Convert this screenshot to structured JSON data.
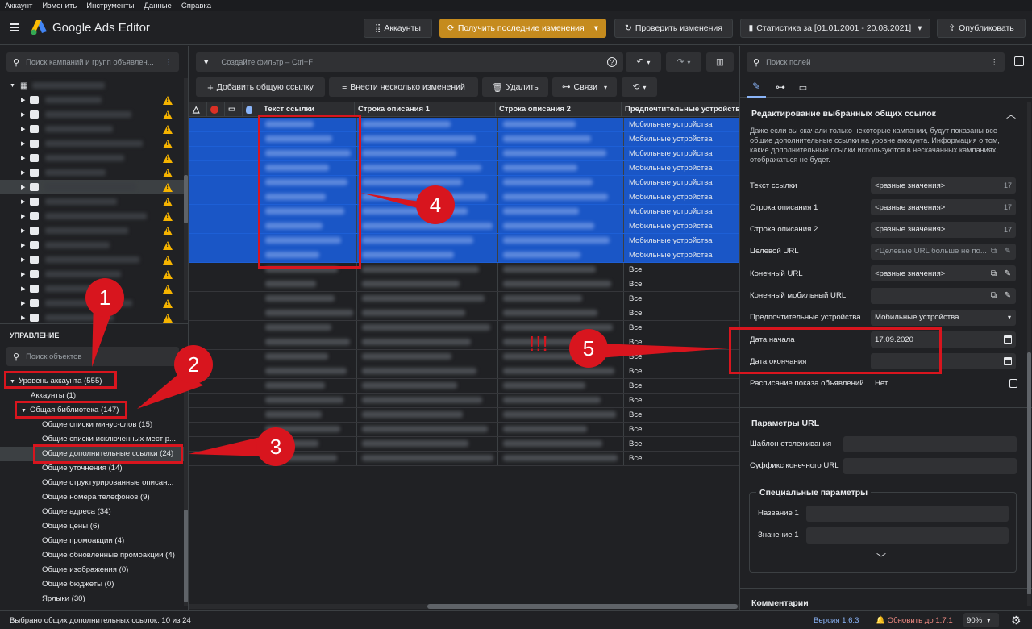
{
  "menu": [
    "Аккаунт",
    "Изменить",
    "Инструменты",
    "Данные",
    "Справка"
  ],
  "app_title": "Google Ads Editor",
  "toolbar": {
    "accounts": "Аккаунты",
    "get_changes": "Получить последние изменения",
    "check_changes": "Проверить изменения",
    "stats": "Статистика за [01.01.2001 - 20.08.2021]",
    "publish": "Опубликовать"
  },
  "left": {
    "search_placeholder": "Поиск кампаний и групп объявлен...",
    "management_title": "УПРАВЛЕНИЕ",
    "objects_placeholder": "Поиск объектов",
    "items": [
      "Уровень аккаунта (555)",
      "Аккаунты (1)",
      "Общая библиотека (147)",
      "Общие списки минус-слов (15)",
      "Общие списки исключенных мест р...",
      "Общие дополнительные ссылки (24)",
      "Общие уточнения (14)",
      "Общие структурированные описан...",
      "Общие номера телефонов (9)",
      "Общие адреса (34)",
      "Общие цены (6)",
      "Общие промоакции (4)",
      "Общие обновленные промоакции (4)",
      "Общие изображения (0)",
      "Общие бюджеты (0)",
      "Ярлыки (30)"
    ]
  },
  "center": {
    "filter_placeholder": "Создайте фильтр – Ctrl+F",
    "add_link": "Добавить общую ссылку",
    "bulk": "Внести несколько изменений",
    "delete": "Удалить",
    "links": "Связи",
    "columns": [
      "Текст ссылки",
      "Строка описания 1",
      "Строка описания 2",
      "Предпочтительные устройства"
    ],
    "mobile": "Мобильные устройства",
    "all": "Все",
    "exclaim": "!!!"
  },
  "right": {
    "search_placeholder": "Поиск полей",
    "section_title": "Редактирование выбранных общих ссылок",
    "info": "Даже если вы скачали только некоторые кампании, будут показаны все общие дополнительные ссылки на уровне аккаунта. Информация о том, какие дополнительные ссылки используются в нескачанных кампаниях, отображаться не будет.",
    "fields": [
      {
        "label": "Текст ссылки",
        "value": "<разные значения>",
        "count": "17"
      },
      {
        "label": "Строка описания 1",
        "value": "<разные значения>",
        "count": "17"
      },
      {
        "label": "Строка описания 2",
        "value": "<разные значения>",
        "count": "17"
      },
      {
        "label": "Целевой URL",
        "value": "<Целевые URL больше не по...",
        "count": ""
      },
      {
        "label": "Конечный URL",
        "value": "<разные значения>",
        "count": ""
      },
      {
        "label": "Конечный мобильный URL",
        "value": "",
        "count": ""
      },
      {
        "label": "Предпочтительные устройства",
        "value": "Мобильные устройства",
        "count": ""
      },
      {
        "label": "Дата начала",
        "value": "17.09.2020",
        "count": ""
      },
      {
        "label": "Дата окончания",
        "value": "",
        "count": ""
      },
      {
        "label": "Расписание показа объявлений",
        "value": "Нет",
        "count": ""
      }
    ],
    "url_params_title": "Параметры URL",
    "tracking_label": "Шаблон отслеживания",
    "suffix_label": "Суффикс конечного URL",
    "custom_title": "Специальные параметры",
    "name1": "Название 1",
    "value1": "Значение 1",
    "comments": "Комментарии"
  },
  "status": {
    "selected": "Выбрано общих дополнительных ссылок: 10 из 24",
    "version": "Версия 1.6.3",
    "update": "Обновить до 1.7.1",
    "zoom": "90%"
  },
  "annotations": [
    "1",
    "2",
    "3",
    "4",
    "5"
  ],
  "colors": {
    "accent_blue": "#1a56c6",
    "orange": "#c58b1e",
    "annotation_red": "#d8151e",
    "warning": "#f6b400"
  }
}
